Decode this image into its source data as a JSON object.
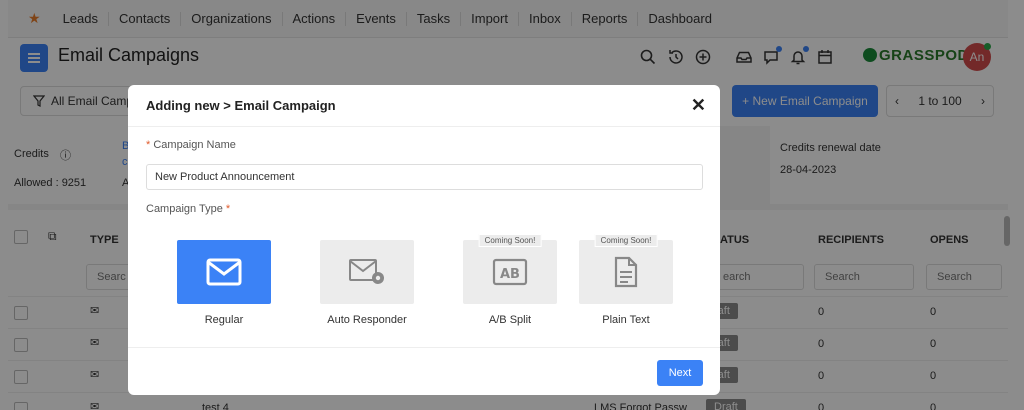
{
  "nav": {
    "items": [
      "Leads",
      "Contacts",
      "Organizations",
      "Actions",
      "Events",
      "Tasks",
      "Import",
      "Inbox",
      "Reports",
      "Dashboard"
    ]
  },
  "header": {
    "title": "Email Campaigns",
    "brand": "GRASSPODS",
    "avatar_initials": "An"
  },
  "toolbar": {
    "filter_label": "All Email Camp",
    "new_button": "+ New Email Campaign",
    "pager": "1 to 100"
  },
  "credits": {
    "label": "Credits",
    "allowed": "Allowed : 9251",
    "col_b": "B",
    "col_c": "c",
    "col_a": "A",
    "renewal_label": "Credits renewal date",
    "renewal_date": "28-04-2023"
  },
  "table": {
    "headers": {
      "type": "TYPE",
      "status": "ATUS",
      "recipients": "RECIPIENTS",
      "opens": "OPENS"
    },
    "search_placeholders": {
      "type": "Searc",
      "status": "earch",
      "recipients": "Search",
      "opens": "Search"
    },
    "rows": [
      {
        "status": "raft",
        "recipients": "0",
        "opens": "0"
      },
      {
        "status": "raft",
        "recipients": "0",
        "opens": "0"
      },
      {
        "status": "raft",
        "recipients": "0",
        "opens": "0"
      },
      {
        "name": "test 4",
        "template": "LMS Forgot Passw",
        "status": "Draft",
        "recipients": "0",
        "opens": "0"
      }
    ]
  },
  "modal": {
    "title": "Adding new > Email Campaign",
    "name_label": "Campaign Name",
    "name_required": "*",
    "name_value": "New Product Announcement",
    "type_label": "Campaign Type",
    "type_required": "*",
    "types": [
      {
        "label": "Regular",
        "badge": "",
        "selected": true,
        "icon": "envelope-icon"
      },
      {
        "label": "Auto Responder",
        "badge": "",
        "selected": false,
        "icon": "envelope-gear-icon"
      },
      {
        "label": "A/B Split",
        "badge": "Coming Soon!",
        "selected": false,
        "icon": "ab-icon"
      },
      {
        "label": "Plain Text",
        "badge": "Coming Soon!",
        "selected": false,
        "icon": "document-icon"
      }
    ],
    "next_label": "Next"
  },
  "colors": {
    "primary": "#3b82f6",
    "accent_star": "#e87c2a",
    "draft_badge": "#8a8a8a"
  }
}
